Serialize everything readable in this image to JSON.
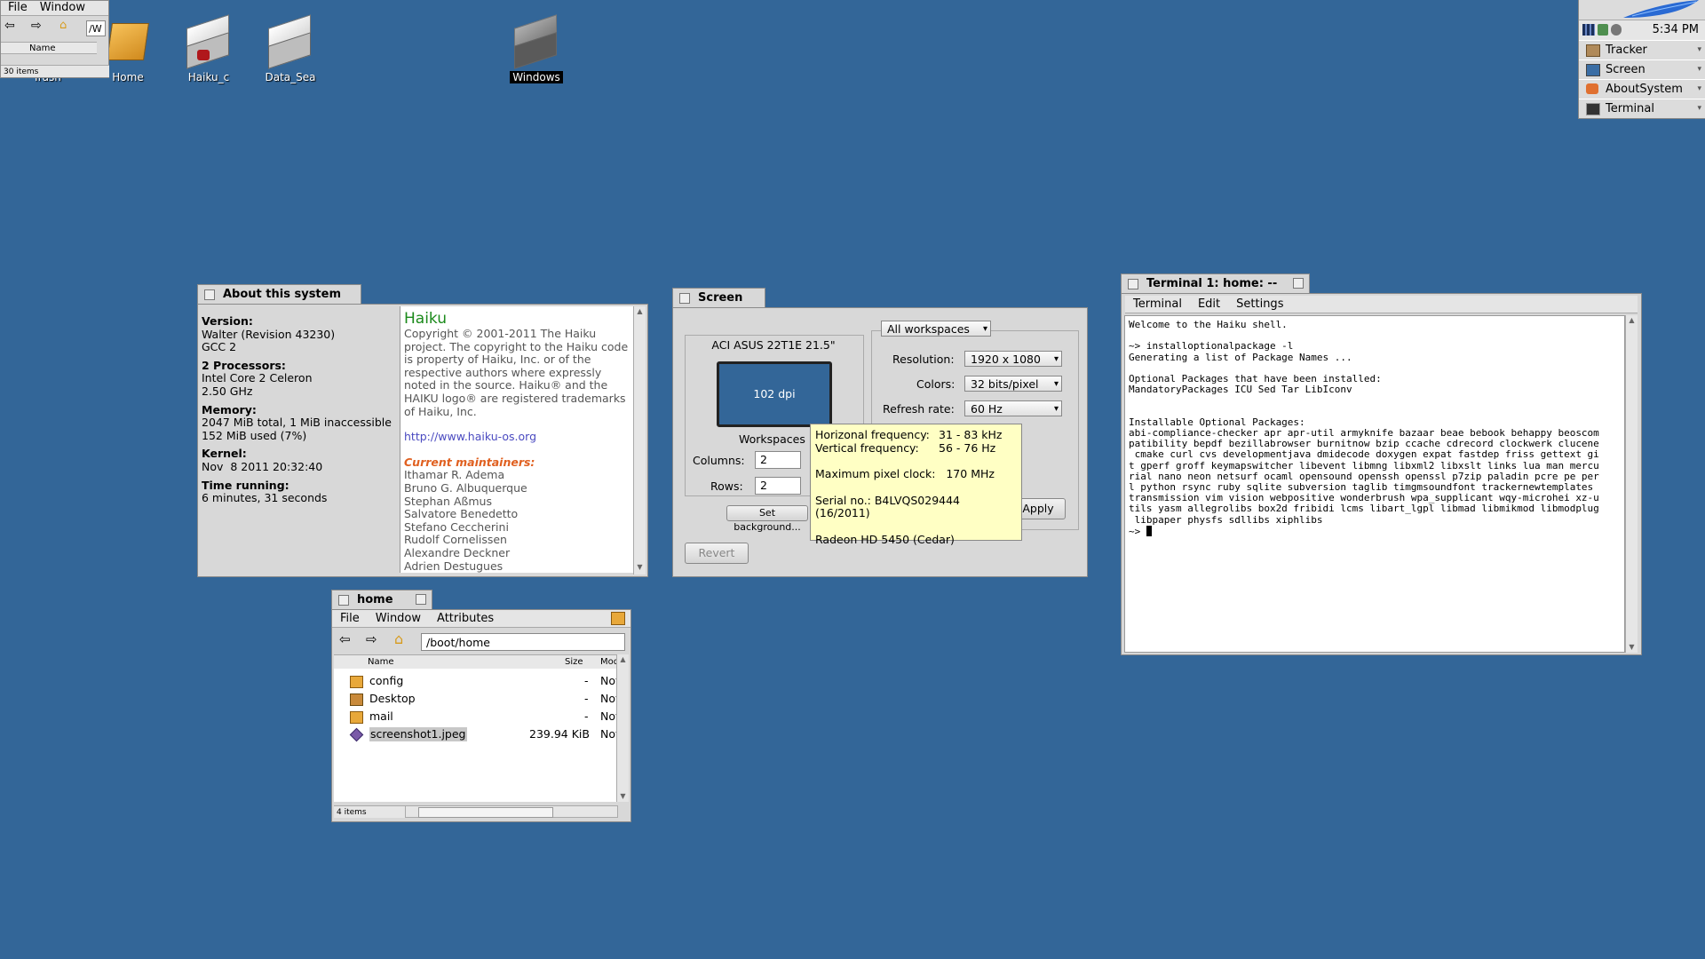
{
  "desktop_icons": [
    {
      "label": "Trash"
    },
    {
      "label": "Home"
    },
    {
      "label": "Haiku_c"
    },
    {
      "label": "Data_Sea"
    },
    {
      "label": "Windows"
    }
  ],
  "mini_tracker": {
    "menu": [
      "File",
      "Window"
    ],
    "path_fragment": "/W",
    "column_name": "Name",
    "status": "30 items"
  },
  "deskbar": {
    "time": "5:34 PM",
    "apps": [
      "Tracker",
      "Screen",
      "AboutSystem",
      "Terminal"
    ]
  },
  "about": {
    "title": "About this system",
    "version_label": "Version:",
    "version_value": "Walter (Revision 43230)",
    "gcc": "GCC 2",
    "processors_label": "2 Processors:",
    "processors_value": "Intel Core 2 Celeron",
    "clock": "2.50 GHz",
    "memory_label": "Memory:",
    "memory_line1": "2047 MiB total, 1 MiB inaccessible",
    "memory_line2": "152 MiB used (7%)",
    "kernel_label": "Kernel:",
    "kernel_value": "Nov  8 2011 20:32:40",
    "time_label": "Time running:",
    "time_value": "6 minutes, 31 seconds",
    "haiku_title": "Haiku",
    "copyright": "Copyright © 2001-2011 The Haiku project. The copyright to the Haiku code is property of Haiku, Inc. or of the respective authors where expressly noted in the source. Haiku® and the HAIKU logo® are registered trademarks of Haiku, Inc.",
    "url": "http://www.haiku-os.org",
    "maintainers_heading": "Current maintainers:",
    "maintainers": [
      "Ithamar R. Adema",
      "Bruno G. Albuquerque",
      "Stephan Aßmus",
      "Salvatore Benedetto",
      "Stefano Ceccherini",
      "Rudolf Cornelissen",
      "Alexandre Deckner",
      "Adrien Destugues"
    ]
  },
  "screen": {
    "title": "Screen",
    "monitor_name": "ACI ASUS 22T1E 21.5\"",
    "dpi": "102 dpi",
    "workspaces_label": "Workspaces",
    "columns_label": "Columns:",
    "columns_value": "2",
    "rows_label": "Rows:",
    "rows_value": "2",
    "set_background": "Set background...",
    "revert": "Revert",
    "scope": "All workspaces",
    "resolution_label": "Resolution:",
    "resolution_value": "1920 x 1080",
    "colors_label": "Colors:",
    "colors_value": "32 bits/pixel",
    "refresh_label": "Refresh rate:",
    "refresh_value": "60 Hz",
    "apply": "Apply",
    "tooltip": {
      "hfreq_label": "Horizonal frequency:",
      "hfreq_value": "31 - 83 kHz",
      "vfreq_label": "Vertical frequency:",
      "vfreq_value": "56 - 76 Hz",
      "pixelclock": "Maximum pixel clock:   170 MHz",
      "serial": "Serial no.: B4LVQS029444 (16/2011)",
      "gpu": "Radeon HD 5450 (Cedar)"
    }
  },
  "home_window": {
    "title": "home",
    "menu": [
      "File",
      "Window",
      "Attributes"
    ],
    "path": "/boot/home",
    "col_name": "Name",
    "col_size": "Size",
    "col_mod": "Mod",
    "files": [
      {
        "name": "config",
        "size": "-",
        "mod": "Nov"
      },
      {
        "name": "Desktop",
        "size": "-",
        "mod": "Nov"
      },
      {
        "name": "mail",
        "size": "-",
        "mod": "Nov"
      },
      {
        "name": "screenshot1.jpeg",
        "size": "239.94 KiB",
        "mod": "Nov"
      }
    ],
    "status": "4 items"
  },
  "terminal": {
    "title": "Terminal 1: home: --",
    "menu": [
      "Terminal",
      "Edit",
      "Settings"
    ],
    "content": "Welcome to the Haiku shell.\n\n~> installoptionalpackage -l\nGenerating a list of Package Names ...\n\nOptional Packages that have been installed:\nMandatoryPackages ICU Sed Tar LibIconv\n\n\nInstallable Optional Packages:\nabi-compliance-checker apr apr-util armyknife bazaar beae bebook behappy beoscom\npatibility bepdf bezillabrowser burnitnow bzip ccache cdrecord clockwerk clucene\n cmake curl cvs developmentjava dmidecode doxygen expat fastdep friss gettext gi\nt gperf groff keymapswitcher libevent libmng libxml2 libxslt links lua man mercu\nrial nano neon netsurf ocaml opensound openssh openssl p7zip paladin pcre pe per\nl python rsync ruby sqlite subversion taglib timgmsoundfont trackernewtemplates\ntransmission vim vision webpositive wonderbrush wpa_supplicant wqy-microhei xz-u\ntils yasm allegrolibs box2d fribidi lcms libart_lgpl libmad libmikmod libmodplug\n libpaper physfs sdllibs xiphlibs\n~> "
  }
}
